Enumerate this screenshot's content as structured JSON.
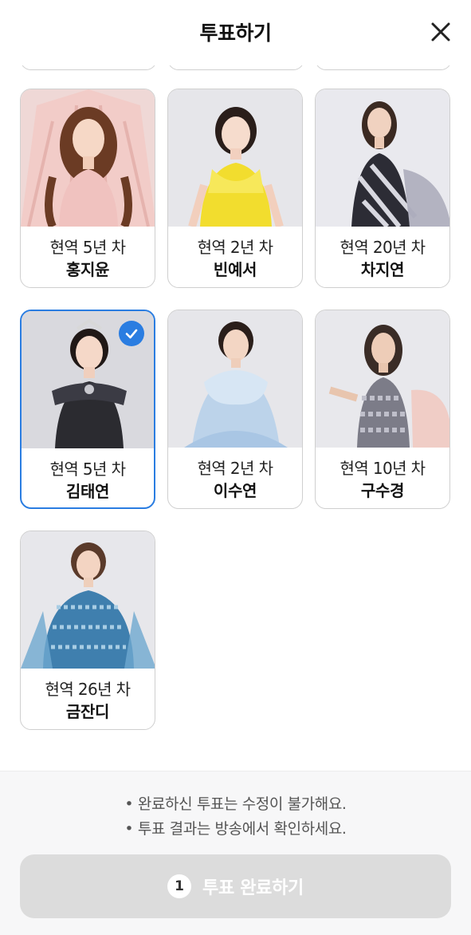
{
  "header": {
    "title": "투표하기"
  },
  "candidates": [
    {
      "career": "현역 5년 차",
      "name": "홍지윤",
      "selected": false
    },
    {
      "career": "현역 2년 차",
      "name": "빈예서",
      "selected": false
    },
    {
      "career": "현역 20년 차",
      "name": "차지연",
      "selected": false
    },
    {
      "career": "현역 5년 차",
      "name": "김태연",
      "selected": true
    },
    {
      "career": "현역 2년 차",
      "name": "이수연",
      "selected": false
    },
    {
      "career": "현역 10년 차",
      "name": "구수경",
      "selected": false
    },
    {
      "career": "현역 26년 차",
      "name": "금잔디",
      "selected": false
    }
  ],
  "notices": [
    "• 완료하신 투표는 수정이 불가해요.",
    "• 투표 결과는 방송에서 확인하세요."
  ],
  "submit": {
    "count": "1",
    "label": "투표 완료하기"
  },
  "colors": {
    "accent": "#2a7de1",
    "button_disabled": "#dcdcdc"
  }
}
